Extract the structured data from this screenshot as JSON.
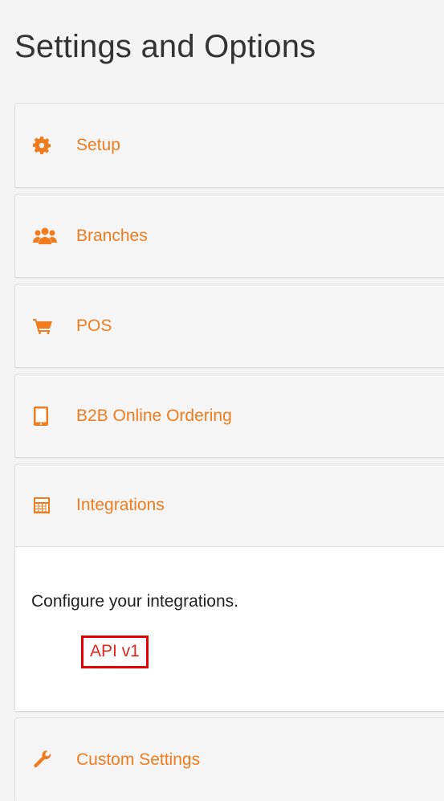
{
  "page": {
    "title": "Settings and Options"
  },
  "accent_color": "#f07c1e",
  "panels": [
    {
      "label": "Setup",
      "icon": "gear-icon"
    },
    {
      "label": "Branches",
      "icon": "users-icon"
    },
    {
      "label": "POS",
      "icon": "cart-icon"
    },
    {
      "label": "B2B Online Ordering",
      "icon": "tablet-icon"
    },
    {
      "label": "Integrations",
      "icon": "calculator-icon",
      "expanded": true,
      "description": "Configure your integrations.",
      "link_label": "API v1",
      "link_highlight_color": "#e00000"
    },
    {
      "label": "Custom Settings",
      "icon": "wrench-icon"
    }
  ]
}
